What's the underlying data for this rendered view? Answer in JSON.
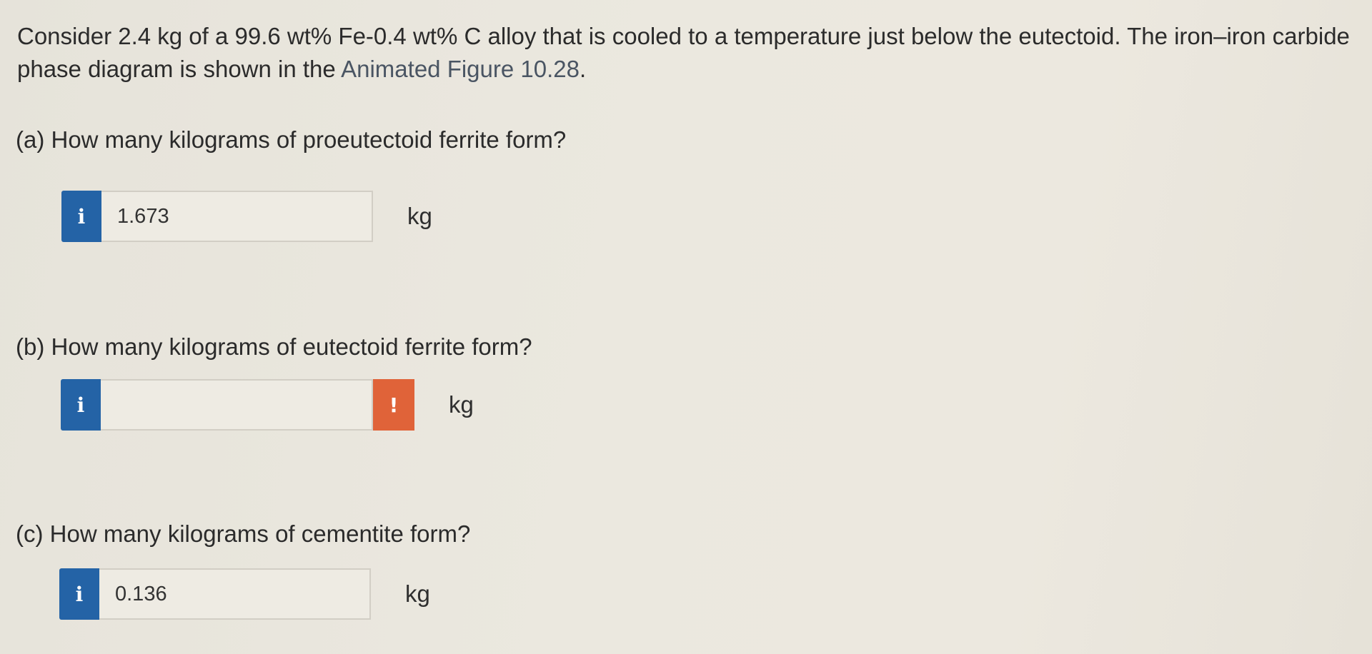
{
  "intro": {
    "text": "Consider 2.4 kg of a 99.6 wt% Fe-0.4 wt% C alloy that is cooled to a temperature just below the eutectoid. The iron–iron carbide phase diagram is shown in the ",
    "figure_link": "Animated Figure 10.28",
    "text_end": "."
  },
  "questions": [
    {
      "prompt": "(a) How many kilograms of proeutectoid ferrite form?",
      "info_icon": "i",
      "answer": "1.673",
      "unit": "kg"
    },
    {
      "prompt": "(b) How many kilograms of eutectoid ferrite form?",
      "info_icon": "i",
      "answer": "",
      "alert_icon": "!",
      "unit": "kg"
    },
    {
      "prompt": "(c) How many kilograms of cementite form?",
      "info_icon": "i",
      "answer": "0.136",
      "unit": "kg"
    }
  ],
  "colors": {
    "info_button": "#2463a6",
    "alert_button": "#e06339",
    "background": "#ebe8df"
  }
}
